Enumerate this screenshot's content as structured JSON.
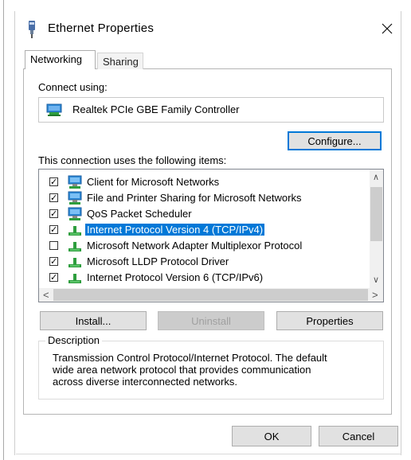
{
  "window": {
    "title": "Ethernet Properties",
    "close_glyph": "✕"
  },
  "tabs": [
    {
      "label": "Networking",
      "active": true
    },
    {
      "label": "Sharing",
      "active": false
    }
  ],
  "connect": {
    "label": "Connect using:",
    "adapter": "Realtek PCIe GBE Family Controller",
    "configure_label": "Configure..."
  },
  "items": {
    "label": "This connection uses the following items:",
    "list": [
      {
        "label": "Client for Microsoft Networks",
        "checked": true,
        "icon": "network-client-icon"
      },
      {
        "label": "File and Printer Sharing for Microsoft Networks",
        "checked": true,
        "icon": "network-service-icon"
      },
      {
        "label": "QoS Packet Scheduler",
        "checked": true,
        "icon": "network-service-icon"
      },
      {
        "label": "Internet Protocol Version 4 (TCP/IPv4)",
        "checked": true,
        "icon": "protocol-icon",
        "selected": true
      },
      {
        "label": "Microsoft Network Adapter Multiplexor Protocol",
        "checked": false,
        "icon": "protocol-icon"
      },
      {
        "label": "Microsoft LLDP Protocol Driver",
        "checked": true,
        "icon": "protocol-icon"
      },
      {
        "label": "Internet Protocol Version 6 (TCP/IPv6)",
        "checked": true,
        "icon": "protocol-icon"
      }
    ],
    "check_glyph": "✓"
  },
  "actions": {
    "install_label": "Install...",
    "uninstall_label": "Uninstall",
    "properties_label": "Properties"
  },
  "description": {
    "legend": "Description",
    "text": "Transmission Control Protocol/Internet Protocol. The default\nwide area network protocol that provides communication\nacross diverse interconnected networks."
  },
  "footer": {
    "ok_label": "OK",
    "cancel_label": "Cancel"
  },
  "colors": {
    "selection": "#0078d7",
    "button_face": "#e1e1e1",
    "icon_blue": "#2d89d6",
    "icon_green": "#2e9e3e"
  }
}
